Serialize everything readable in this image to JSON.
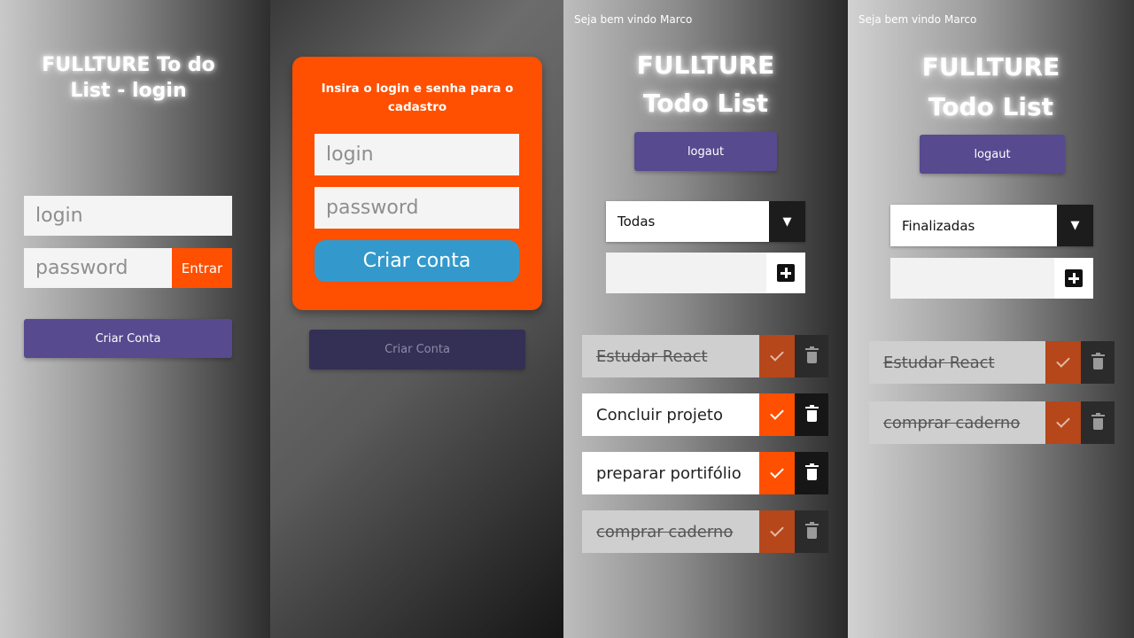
{
  "login_screen": {
    "title_line1": "FULLTURE To do",
    "title_line2": "List - login",
    "login_placeholder": "login",
    "password_placeholder": "password",
    "enter_button": "Entrar",
    "create_account_button": "Criar Conta"
  },
  "signup_screen": {
    "instruction_line1": "Insira o login e senha para o",
    "instruction_line2": "cadastro",
    "login_placeholder": "login",
    "password_placeholder": "password",
    "create_button": "Criar conta",
    "create_account_button": "Criar Conta"
  },
  "todo_all_screen": {
    "welcome": "Seja bem vindo",
    "user": "Marco",
    "title_line1": "FULLTURE",
    "title_line2": "Todo List",
    "logout_button": "logaut",
    "filter_selected": "Todas",
    "tasks": [
      {
        "text": "Estudar React",
        "done": true
      },
      {
        "text": "Concluir projeto",
        "done": false
      },
      {
        "text": "preparar portifólio",
        "done": false
      },
      {
        "text": "comprar caderno",
        "done": true
      }
    ]
  },
  "todo_finished_screen": {
    "welcome": "Seja bem vindo",
    "user": "Marco",
    "title_line1": "FULLTURE",
    "title_line2": "Todo List",
    "logout_button": "logaut",
    "filter_selected": "Finalizadas",
    "tasks": [
      {
        "text": "Estudar React",
        "done": true
      },
      {
        "text": "comprar caderno",
        "done": true
      }
    ]
  },
  "colors": {
    "accent_orange": "#ff4f00",
    "purple_button": "#574a8f",
    "blue_button": "#3399cc"
  },
  "icons": [
    "chevron-down-icon",
    "plus-icon",
    "check-icon",
    "trash-icon"
  ]
}
